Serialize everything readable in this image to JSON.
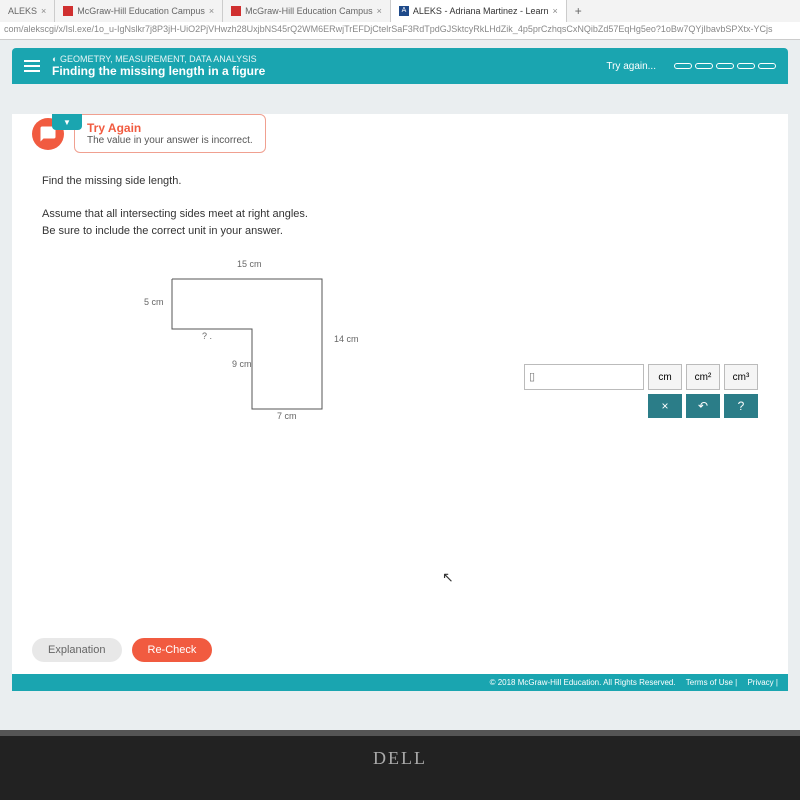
{
  "browser": {
    "tabs": [
      {
        "label": "ALEKS"
      },
      {
        "label": "McGraw-Hill Education Campus"
      },
      {
        "label": "McGraw-Hill Education Campus"
      },
      {
        "label": "ALEKS - Adriana Martinez - Learn"
      }
    ],
    "plus": "+",
    "close": "×",
    "url": "com/alekscgi/x/Isl.exe/1o_u-IgNslkr7j8P3jH-UiO2PjVHwzh28UxjbNS45rQ2WM6ERwjTrEFDjCtelrSaF3RdTpdGJSktcyRkLHdZik_4p5prCzhqsCxNQibZd57EqHg5eo?1oBw7QYjIbavbSPXtx-YCjs"
  },
  "header": {
    "category": "GEOMETRY, MEASUREMENT, DATA ANALYSIS",
    "title": "Finding the missing length in a figure",
    "try_again": "Try again..."
  },
  "feedback": {
    "title": "Try Again",
    "message": "The value in your answer is incorrect."
  },
  "problem": {
    "line1": "Find the missing side length.",
    "line2": "Assume that all intersecting sides meet at right angles.",
    "line3": "Be sure to include the correct unit in your answer."
  },
  "figure": {
    "top": "15 cm",
    "left": "5 cm",
    "unknown": "? .",
    "inner_h": "9 cm",
    "right": "14 cm",
    "bottom": "7 cm"
  },
  "palette": {
    "input_value": "",
    "placeholder": "▯",
    "units": {
      "cm": "cm",
      "cm2": "cm²",
      "cm3": "cm³"
    },
    "controls": {
      "clear": "×",
      "undo": "↶",
      "help": "?"
    }
  },
  "buttons": {
    "explanation": "Explanation",
    "recheck": "Re-Check"
  },
  "footer": {
    "copyright": "© 2018 McGraw-Hill Education. All Rights Reserved.",
    "terms": "Terms of Use",
    "privacy": "Privacy"
  },
  "bezel": {
    "brand": "DELL"
  }
}
